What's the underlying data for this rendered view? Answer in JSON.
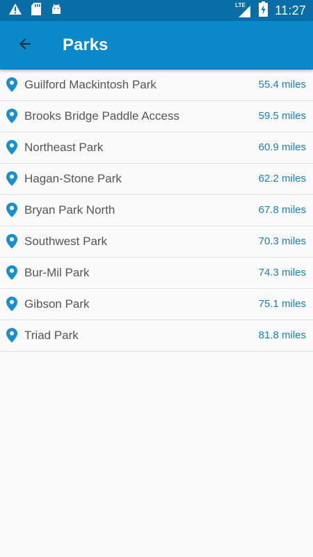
{
  "status_bar": {
    "time": "11:27",
    "network": "LTE",
    "left_icons": [
      "warning-icon",
      "sd-card-icon",
      "android-icon"
    ],
    "right_icons": [
      "signal-icon",
      "battery-charging-icon"
    ]
  },
  "app_bar": {
    "title": "Parks",
    "back_icon": "arrow-left-icon"
  },
  "colors": {
    "status_bar": "#0a6ea6",
    "app_bar": "#0a88c7",
    "pin": "#1a8fce",
    "distance": "#1a7fb5",
    "name": "#555555"
  },
  "parks": [
    {
      "name": "Guilford Mackintosh Park",
      "distance": "55.4 miles"
    },
    {
      "name": "Brooks Bridge Paddle Access",
      "distance": "59.5 miles"
    },
    {
      "name": "Northeast Park",
      "distance": "60.9 miles"
    },
    {
      "name": "Hagan-Stone Park",
      "distance": "62.2 miles"
    },
    {
      "name": "Bryan Park North",
      "distance": "67.8 miles"
    },
    {
      "name": "Southwest Park",
      "distance": "70.3 miles"
    },
    {
      "name": "Bur-Mil Park",
      "distance": "74.3 miles"
    },
    {
      "name": "Gibson Park",
      "distance": "75.1 miles"
    },
    {
      "name": "Triad Park",
      "distance": "81.8 miles"
    }
  ]
}
